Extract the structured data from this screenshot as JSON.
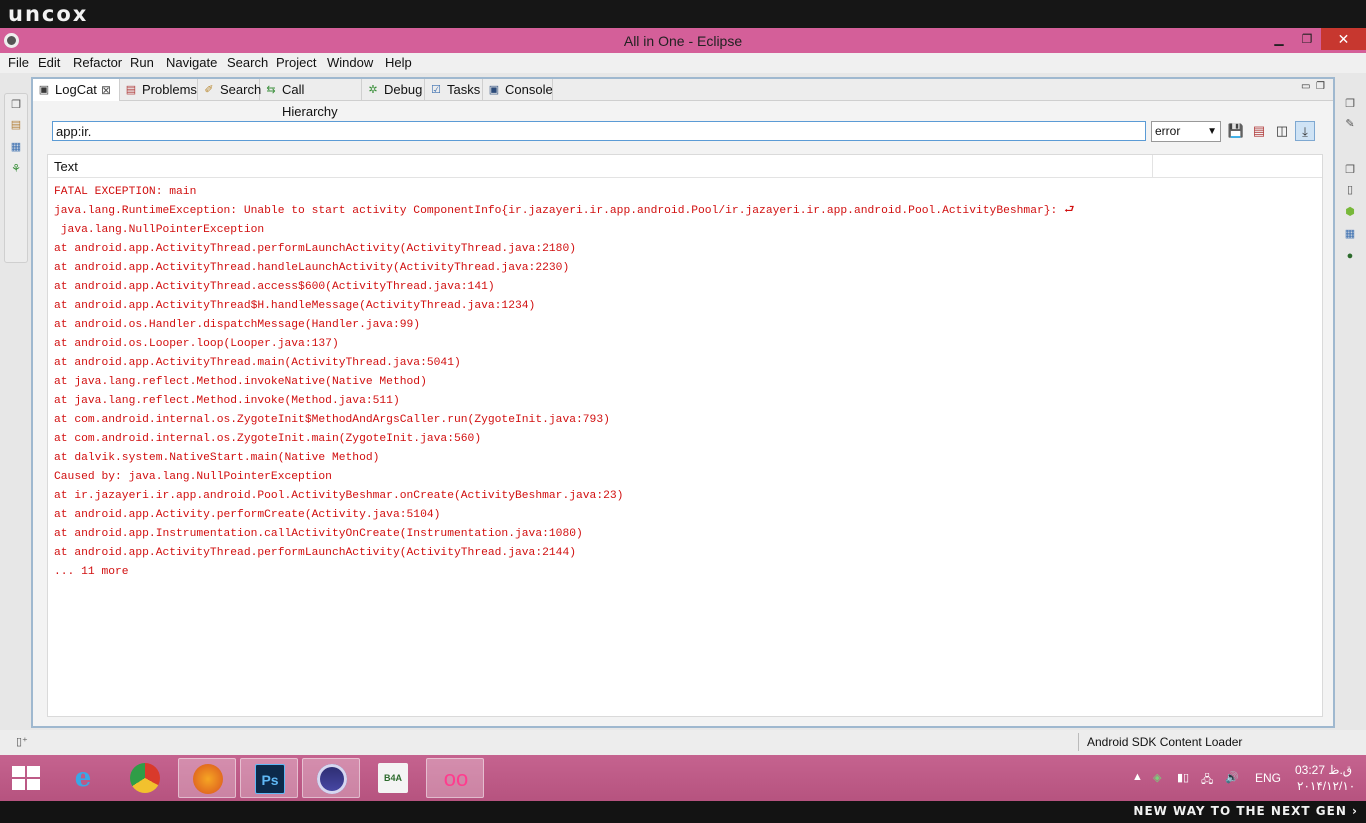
{
  "brand": {
    "logo": "uncox",
    "slogan": "NEW WAY TO THE NEXT GEN ›"
  },
  "window": {
    "title": "All in One - Eclipse",
    "min": "▁",
    "max": "❐",
    "close": "✕"
  },
  "menu": [
    "File",
    "Edit",
    "Refactor",
    "Run",
    "Navigate",
    "Search",
    "Project",
    "Window",
    "Help"
  ],
  "tabs": [
    {
      "label": "LogCat",
      "icon": "logcat-icon",
      "active": true
    },
    {
      "label": "Problems",
      "icon": "problems-icon"
    },
    {
      "label": "Search",
      "icon": "search-icon"
    },
    {
      "label": "Call Hierarchy",
      "icon": "call-hierarchy-icon"
    },
    {
      "label": "Debug",
      "icon": "debug-icon"
    },
    {
      "label": "Tasks",
      "icon": "tasks-icon"
    },
    {
      "label": "Console",
      "icon": "console-icon"
    }
  ],
  "logcat": {
    "filter_value": "app:ir.",
    "level": "error",
    "column_header": "Text",
    "lines": [
      "FATAL EXCEPTION: main",
      "java.lang.RuntimeException: Unable to start activity ComponentInfo{ir.jazayeri.ir.app.android.Pool/ir.jazayeri.ir.app.android.Pool.ActivityBeshmar}: ⮐",
      " java.lang.NullPointerException",
      "at android.app.ActivityThread.performLaunchActivity(ActivityThread.java:2180)",
      "at android.app.ActivityThread.handleLaunchActivity(ActivityThread.java:2230)",
      "at android.app.ActivityThread.access$600(ActivityThread.java:141)",
      "at android.app.ActivityThread$H.handleMessage(ActivityThread.java:1234)",
      "at android.os.Handler.dispatchMessage(Handler.java:99)",
      "at android.os.Looper.loop(Looper.java:137)",
      "at android.app.ActivityThread.main(ActivityThread.java:5041)",
      "at java.lang.reflect.Method.invokeNative(Native Method)",
      "at java.lang.reflect.Method.invoke(Method.java:511)",
      "at com.android.internal.os.ZygoteInit$MethodAndArgsCaller.run(ZygoteInit.java:793)",
      "at com.android.internal.os.ZygoteInit.main(ZygoteInit.java:560)",
      "at dalvik.system.NativeStart.main(Native Method)",
      "Caused by: java.lang.NullPointerException",
      "at ir.jazayeri.ir.app.android.Pool.ActivityBeshmar.onCreate(ActivityBeshmar.java:23)",
      "at android.app.Activity.performCreate(Activity.java:5104)",
      "at android.app.Instrumentation.callActivityOnCreate(Instrumentation.java:1080)",
      "at android.app.ActivityThread.performLaunchActivity(ActivityThread.java:2144)",
      "... 11 more"
    ]
  },
  "status": {
    "text": "Android SDK Content Loader"
  },
  "taskbar": {
    "apps": [
      "internet-explorer-icon",
      "chrome-icon",
      "firefox-icon",
      "photoshop-icon",
      "eclipse-icon",
      "basic4android-icon",
      "flickr-icon"
    ],
    "ps_label": "Ps",
    "lang": "ENG",
    "time": "03:27 ق.ظ",
    "date": "۲۰۱۴/۱۲/۱۰"
  },
  "colors": {
    "title_bar": "#d45f99",
    "taskbar": "#c5638f",
    "log_text": "#d10f0f",
    "focus_border": "#5b9bd5"
  }
}
